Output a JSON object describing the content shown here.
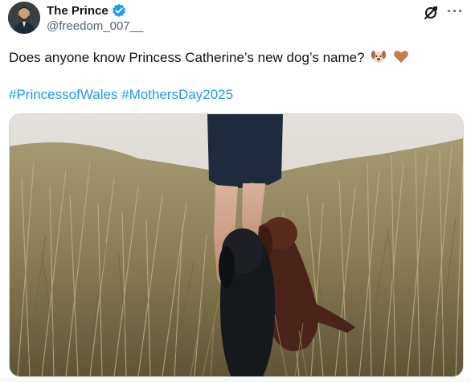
{
  "author": {
    "display_name": "The Prince",
    "handle": "@freedom_007__",
    "verified": true,
    "avatar_icon": "person-avatar-icon"
  },
  "header_icons": {
    "grok": "grok-icon",
    "more": "more-icon",
    "more_glyph": "···"
  },
  "post": {
    "text": "Does anyone know Princess Catherine’s new dog’s name?",
    "emojis": [
      "dog-face-emoji",
      "brown-heart-emoji"
    ],
    "hashtags": [
      "#PrincessofWales",
      "#MothersDay2025"
    ]
  },
  "media": {
    "type": "photo",
    "subject": "legs walking through dune grass with two spaniel dogs"
  },
  "colors": {
    "link": "#1d9bf0",
    "verified": "#1d9bf0",
    "secondary_text": "#536471",
    "brown_heart": "#c97b4f"
  }
}
